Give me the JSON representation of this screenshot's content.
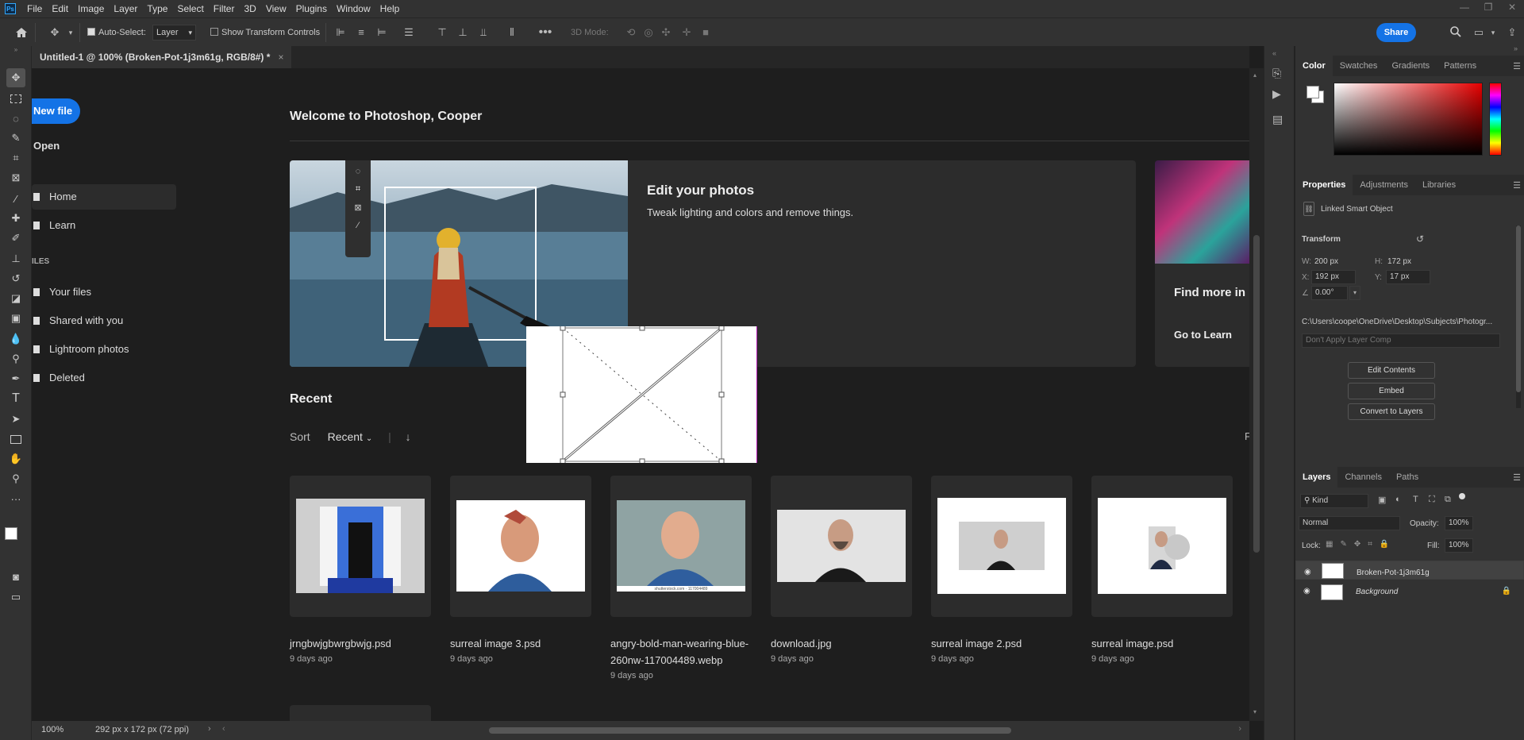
{
  "app": {
    "logo": "Ps",
    "menu": [
      "File",
      "Edit",
      "Image",
      "Layer",
      "Type",
      "Select",
      "Filter",
      "3D",
      "View",
      "Plugins",
      "Window",
      "Help"
    ]
  },
  "options_bar": {
    "auto_select_label": "Auto-Select:",
    "auto_select_target": "Layer",
    "show_transform_label": "Show Transform Controls",
    "three_d_mode_label": "3D Mode:",
    "share_label": "Share"
  },
  "document_tab": {
    "title": "Untitled-1 @ 100% (Broken-Pot-1j3m61g, RGB/8#) *",
    "close": "×"
  },
  "home": {
    "new_file": "New file",
    "open": "Open",
    "nav": [
      {
        "label": "Home"
      },
      {
        "label": "Learn"
      }
    ],
    "files_heading": "ILES",
    "file_links": [
      {
        "label": "Your files"
      },
      {
        "label": "Shared with you"
      },
      {
        "label": "Lightroom photos"
      },
      {
        "label": "Deleted"
      }
    ],
    "welcome": "Welcome to Photoshop, Cooper",
    "hero": {
      "title": "Edit your photos",
      "subtitle": "Tweak lighting and colors and remove things."
    },
    "learn_card": {
      "title": "Find more in",
      "link": "Go to Learn"
    },
    "recent_heading": "Recent",
    "sort_label": "Sort",
    "sort_value": "Recent",
    "filter_cut": "F",
    "recent_files": [
      {
        "name": "jrngbwjgbwrgbwjg.psd",
        "date": "9 days ago"
      },
      {
        "name": "surreal image 3.psd",
        "date": "9 days ago"
      },
      {
        "name": "angry-bold-man-wearing-blue-260nw-117004489.webp",
        "date": "9 days ago"
      },
      {
        "name": "download.jpg",
        "date": "9 days ago"
      },
      {
        "name": "surreal image 2.psd",
        "date": "9 days ago"
      },
      {
        "name": "surreal image.psd",
        "date": "9 days ago"
      }
    ],
    "watermark_text": "shutterstock.com · 117004489"
  },
  "status_bar": {
    "zoom": "100%",
    "doc_size": "292 px x 172 px (72 ppi)"
  },
  "color_panel": {
    "tabs": [
      "Color",
      "Swatches",
      "Gradients",
      "Patterns"
    ]
  },
  "properties_panel": {
    "tabs": [
      "Properties",
      "Adjustments",
      "Libraries"
    ],
    "object_type": "Linked Smart Object",
    "transform_heading": "Transform",
    "w_label": "W:",
    "w_value": "200 px",
    "h_label": "H:",
    "h_value": "172 px",
    "x_label": "X:",
    "x_value": "192 px",
    "y_label": "Y:",
    "y_value": "17 px",
    "angle_value": "0.00°",
    "path": "C:\\Users\\coope\\OneDrive\\Desktop\\Subjects\\Photogr...",
    "layer_comp": "Don't Apply Layer Comp",
    "buttons": [
      "Edit Contents",
      "Embed",
      "Convert to Layers"
    ]
  },
  "layers_panel": {
    "tabs": [
      "Layers",
      "Channels",
      "Paths"
    ],
    "filter_kind": "Kind",
    "blend_mode": "Normal",
    "opacity_label": "Opacity:",
    "opacity_value": "100%",
    "lock_label": "Lock:",
    "fill_label": "Fill:",
    "fill_value": "100%",
    "layers": [
      {
        "name": "Broken-Pot-1j3m61g",
        "selected": true
      },
      {
        "name": "Background",
        "selected": false
      }
    ]
  },
  "colors": {
    "accent": "#1473e6",
    "panel": "#323232",
    "canvas": "#1e1e1e"
  }
}
